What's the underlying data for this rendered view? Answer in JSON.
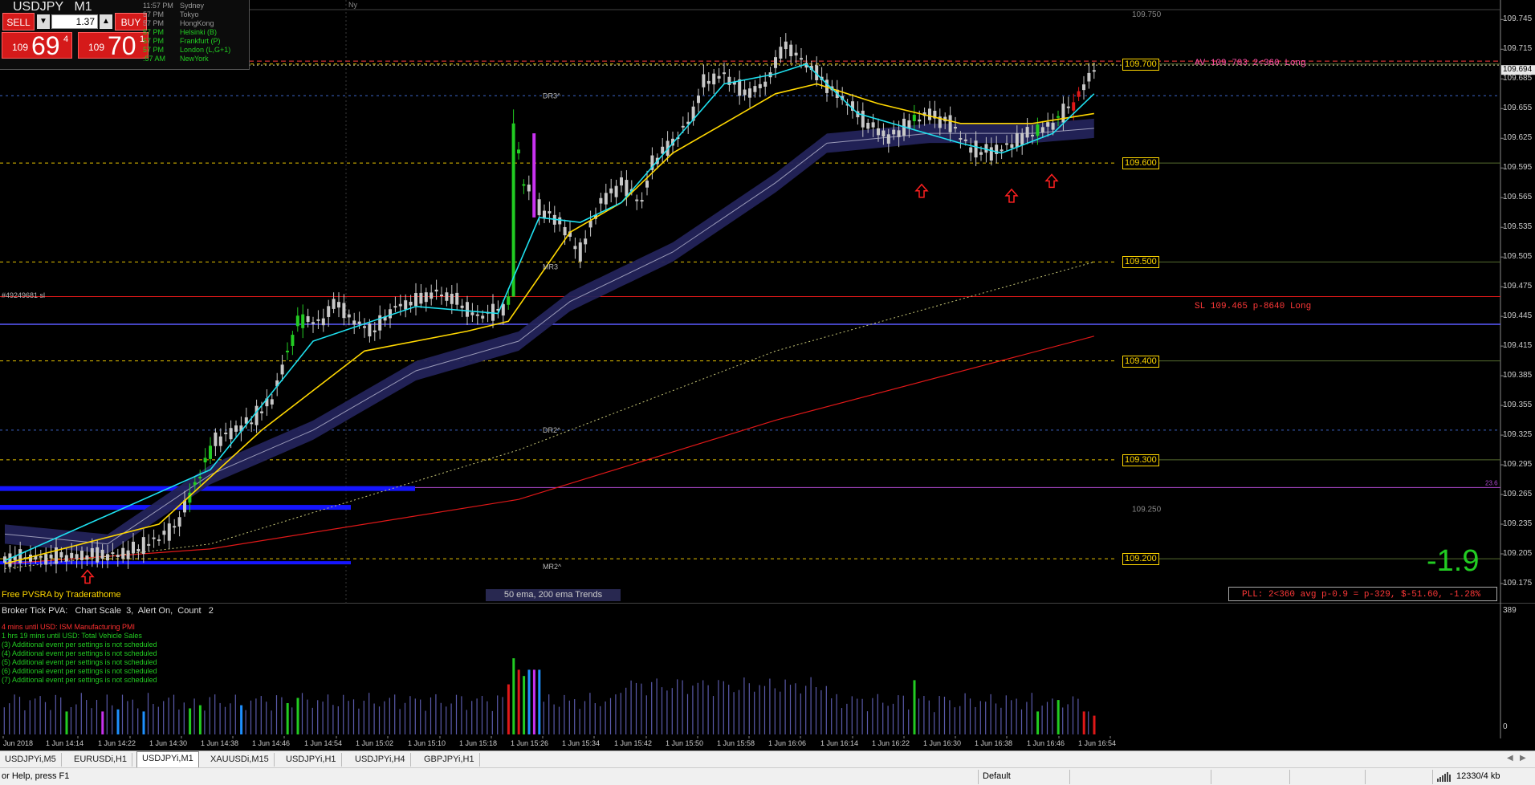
{
  "trade_panel": {
    "symbol": "USDJPY",
    "timeframe": "M1",
    "sell_label": "SELL",
    "buy_label": "BUY",
    "lot": "1.37",
    "sell_price": {
      "big": "109",
      "pips": "69",
      "frac": "4"
    },
    "buy_price": {
      "big": "109",
      "pips": "70",
      "frac": "1"
    }
  },
  "sessions": [
    {
      "time": "11:57 PM",
      "name": "Sydney",
      "color": "#9a9a9a"
    },
    {
      "time": "57 PM",
      "name": "Tokyo",
      "color": "#9a9a9a"
    },
    {
      "time": "57 PM",
      "name": "HongKong",
      "color": "#9a9a9a"
    },
    {
      "time": "57 PM",
      "name": "Helsinki (B)",
      "color": "#22cc22"
    },
    {
      "time": "57 PM",
      "name": "Frankfurt (P)",
      "color": "#22cc22"
    },
    {
      "time": "57 PM",
      "name": "London (L,G+1)",
      "color": "#22cc22"
    },
    {
      "time": ":57 AM",
      "name": "NewYork",
      "color": "#22cc22"
    }
  ],
  "ny_label": "Ny",
  "order_ref": "#49249681 sl",
  "price_axis": [
    "109.745",
    "109.715",
    "109.685",
    "109.655",
    "109.625",
    "109.595",
    "109.565",
    "109.535",
    "109.505",
    "109.475",
    "109.445",
    "109.415",
    "109.385",
    "109.355",
    "109.325",
    "109.295",
    "109.265",
    "109.235",
    "109.205",
    "109.175"
  ],
  "current_price_label": "109.694",
  "level_boxes": [
    {
      "label": "109.700",
      "price": 109.7
    },
    {
      "label": "109.600",
      "price": 109.6
    },
    {
      "label": "109.500",
      "price": 109.5
    },
    {
      "label": "109.400",
      "price": 109.4
    },
    {
      "label": "109.300",
      "price": 109.3
    },
    {
      "label": "109.200",
      "price": 109.2
    }
  ],
  "round_labels": [
    {
      "label": "109.750",
      "price": 109.75
    },
    {
      "label": "109.250",
      "price": 109.25
    }
  ],
  "pivot_labels": [
    {
      "label": "DR3^",
      "price": 109.668
    },
    {
      "label": "MR3",
      "price": 109.495
    },
    {
      "label": "DR2^",
      "price": 109.33
    },
    {
      "label": "MR2^",
      "price": 109.192
    }
  ],
  "fib_label": "23.6",
  "av_text": "AV 109.703 2<360 Long",
  "sl_text": "SL 109.465 p-8640 Long",
  "pvsra_label": "Free PVSRA by Traderathome",
  "ema_label": "50 ema, 200 ema Trends",
  "pnl_value": "-1.9",
  "pll_text": "PLL: 2<360 avg p-0.9 = p-329, $-51.60, -1.28%",
  "indicator_header": "Broker Tick PVA:   Chart Scale  3,  Alert On,  Count   2",
  "news": [
    {
      "text": "4 mins until USD: ISM Manufacturing PMI",
      "color": "#ff3030"
    },
    {
      "text": "1 hrs 19 mins until USD: Total Vehicle Sales",
      "color": "#22cc22"
    },
    {
      "text": "(3)  Additional event per settings is not scheduled",
      "color": "#22cc22"
    },
    {
      "text": "(4)  Additional event per settings is not scheduled",
      "color": "#22cc22"
    },
    {
      "text": "(5)  Additional event per settings is not scheduled",
      "color": "#22cc22"
    },
    {
      "text": "(6)  Additional event per settings is not scheduled",
      "color": "#22cc22"
    },
    {
      "text": "(7)  Additional event per settings is not scheduled",
      "color": "#22cc22"
    }
  ],
  "volume_scale": {
    "max": "389",
    "min": "0"
  },
  "time_axis": [
    "Jun 2018",
    "1 Jun 14:14",
    "1 Jun 14:22",
    "1 Jun 14:30",
    "1 Jun 14:38",
    "1 Jun 14:46",
    "1 Jun 14:54",
    "1 Jun 15:02",
    "1 Jun 15:10",
    "1 Jun 15:18",
    "1 Jun 15:26",
    "1 Jun 15:34",
    "1 Jun 15:42",
    "1 Jun 15:50",
    "1 Jun 15:58",
    "1 Jun 16:06",
    "1 Jun 16:14",
    "1 Jun 16:22",
    "1 Jun 16:30",
    "1 Jun 16:38",
    "1 Jun 16:46",
    "1 Jun 16:54"
  ],
  "tabs": [
    "USDJPYi,M5",
    "EURUSDi,H1",
    "USDJPYi,M1",
    "XAUUSDi,M15",
    "USDJPYi,H1",
    "USDJPYi,H4",
    "GBPJPYi,H1"
  ],
  "active_tab": 2,
  "status": {
    "help": "or Help, press F1",
    "profile": "Default",
    "traffic": "12330/4 kb"
  },
  "colors": {
    "bull_candle": "#22cc22",
    "bear_candle": "#c8c8c8",
    "climax_bull": "#22cc22",
    "climax_bear": "#e01818",
    "rising_volume": "#1e90ff",
    "magenta": "#c832f0",
    "ema_fast": "#1ee1f0",
    "ema_slow": "#ffd700",
    "ema200": "#e01818",
    "level_line": "#ffd700",
    "sl_line": "#e01818",
    "blue_line": "#5a5aff"
  },
  "chart_data": {
    "type": "candlestick",
    "y_range": [
      109.175,
      109.755
    ],
    "price_path": [
      [
        0,
        109.2
      ],
      [
        24,
        109.205
      ],
      [
        33,
        109.23
      ],
      [
        38,
        109.285
      ],
      [
        41,
        109.32
      ],
      [
        45,
        109.33
      ],
      [
        48,
        109.34
      ],
      [
        52,
        109.36
      ],
      [
        57,
        109.44
      ],
      [
        62,
        109.44
      ],
      [
        64,
        109.46
      ],
      [
        68,
        109.44
      ],
      [
        72,
        109.43
      ],
      [
        76,
        109.455
      ],
      [
        80,
        109.46
      ],
      [
        84,
        109.47
      ],
      [
        88,
        109.46
      ],
      [
        92,
        109.445
      ],
      [
        96,
        109.45
      ],
      [
        98,
        109.46
      ],
      [
        99,
        109.64
      ],
      [
        101,
        109.58
      ],
      [
        104,
        109.555
      ],
      [
        108,
        109.54
      ],
      [
        112,
        109.51
      ],
      [
        116,
        109.56
      ],
      [
        120,
        109.58
      ],
      [
        124,
        109.56
      ],
      [
        126,
        109.6
      ],
      [
        130,
        109.62
      ],
      [
        134,
        109.65
      ],
      [
        136,
        109.68
      ],
      [
        140,
        109.69
      ],
      [
        144,
        109.67
      ],
      [
        148,
        109.68
      ],
      [
        152,
        109.72
      ],
      [
        156,
        109.7
      ],
      [
        160,
        109.68
      ],
      [
        164,
        109.66
      ],
      [
        168,
        109.64
      ],
      [
        172,
        109.625
      ],
      [
        176,
        109.64
      ],
      [
        180,
        109.65
      ],
      [
        184,
        109.64
      ],
      [
        188,
        109.615
      ],
      [
        192,
        109.61
      ],
      [
        196,
        109.62
      ],
      [
        200,
        109.63
      ],
      [
        204,
        109.64
      ],
      [
        208,
        109.66
      ],
      [
        212,
        109.695
      ]
    ],
    "ema_fast": [
      [
        0,
        109.198
      ],
      [
        40,
        109.29
      ],
      [
        60,
        109.42
      ],
      [
        80,
        109.455
      ],
      [
        96,
        109.448
      ],
      [
        104,
        109.545
      ],
      [
        112,
        109.54
      ],
      [
        120,
        109.56
      ],
      [
        130,
        109.62
      ],
      [
        140,
        109.68
      ],
      [
        150,
        109.69
      ],
      [
        156,
        109.7
      ],
      [
        166,
        109.65
      ],
      [
        176,
        109.635
      ],
      [
        186,
        109.62
      ],
      [
        194,
        109.61
      ],
      [
        204,
        109.63
      ],
      [
        212,
        109.67
      ]
    ],
    "ema_slow": [
      [
        0,
        109.195
      ],
      [
        30,
        109.235
      ],
      [
        50,
        109.33
      ],
      [
        70,
        109.41
      ],
      [
        90,
        109.43
      ],
      [
        98,
        109.44
      ],
      [
        110,
        109.53
      ],
      [
        120,
        109.56
      ],
      [
        130,
        109.61
      ],
      [
        140,
        109.64
      ],
      [
        150,
        109.67
      ],
      [
        158,
        109.68
      ],
      [
        170,
        109.66
      ],
      [
        186,
        109.64
      ],
      [
        200,
        109.64
      ],
      [
        212,
        109.65
      ]
    ],
    "ema50_band": [
      [
        0,
        109.225
      ],
      [
        20,
        109.215
      ],
      [
        40,
        109.285
      ],
      [
        60,
        109.33
      ],
      [
        80,
        109.39
      ],
      [
        100,
        109.42
      ],
      [
        110,
        109.46
      ],
      [
        130,
        109.51
      ],
      [
        150,
        109.58
      ],
      [
        160,
        109.62
      ],
      [
        180,
        109.63
      ],
      [
        200,
        109.63
      ],
      [
        212,
        109.635
      ]
    ],
    "ema200": [
      [
        0,
        109.195
      ],
      [
        40,
        109.21
      ],
      [
        100,
        109.26
      ],
      [
        150,
        109.34
      ],
      [
        212,
        109.425
      ]
    ],
    "ema_dotted": [
      [
        0,
        109.19
      ],
      [
        40,
        109.215
      ],
      [
        100,
        109.31
      ],
      [
        150,
        109.41
      ],
      [
        212,
        109.5
      ]
    ]
  }
}
